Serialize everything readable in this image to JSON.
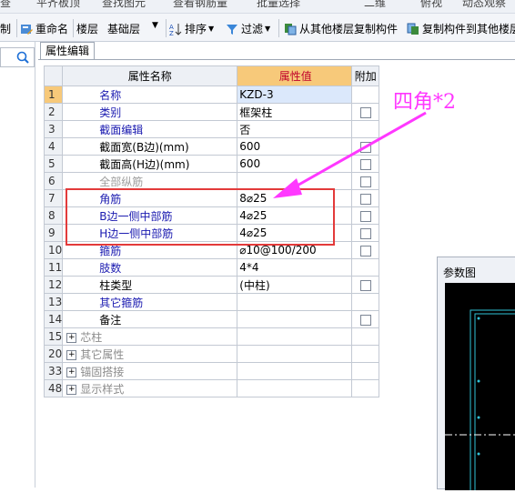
{
  "toolbar_top": {
    "items": [
      "查",
      "平齐板顶",
      "查找图元",
      "查看钢筋量",
      "批量选择",
      "二维",
      "俯视",
      "动态观察"
    ]
  },
  "toolbar": {
    "items": [
      {
        "label": "制"
      },
      {
        "label": "重命名"
      },
      {
        "label": "楼层"
      },
      {
        "label": "基础层"
      },
      {
        "label": "排序"
      },
      {
        "label": "过滤"
      },
      {
        "label": "从其他楼层复制构件"
      },
      {
        "label": "复制构件到其他楼层"
      }
    ]
  },
  "tab": {
    "label": "属性编辑"
  },
  "grid": {
    "headers": {
      "num": "",
      "name": "属性名称",
      "value": "属性值",
      "add": "附加"
    },
    "rows": [
      {
        "num": "1",
        "name": "名称",
        "value": "KZD-3",
        "check": false,
        "style": "blue",
        "selected": true
      },
      {
        "num": "2",
        "name": "类别",
        "value": "框架柱",
        "check": true,
        "style": "blue"
      },
      {
        "num": "3",
        "name": "截面编辑",
        "value": "否",
        "check": false,
        "style": "blue"
      },
      {
        "num": "4",
        "name": "截面宽(B边)(mm)",
        "value": "600",
        "check": true,
        "style": "black"
      },
      {
        "num": "5",
        "name": "截面高(H边)(mm)",
        "value": "600",
        "check": true,
        "style": "black"
      },
      {
        "num": "6",
        "name": "全部纵筋",
        "value": "",
        "check": true,
        "style": "gray"
      },
      {
        "num": "7",
        "name": "角筋",
        "value": "8⌀25",
        "check": true,
        "style": "blue"
      },
      {
        "num": "8",
        "name": "B边一侧中部筋",
        "value": "4⌀25",
        "check": true,
        "style": "blue"
      },
      {
        "num": "9",
        "name": "H边一侧中部筋",
        "value": "4⌀25",
        "check": true,
        "style": "blue"
      },
      {
        "num": "10",
        "name": "箍筋",
        "value": "⌀10@100/200",
        "check": true,
        "style": "blue"
      },
      {
        "num": "11",
        "name": "肢数",
        "value": "4*4",
        "check": false,
        "style": "blue"
      },
      {
        "num": "12",
        "name": "柱类型",
        "value": "(中柱)",
        "check": true,
        "style": "black"
      },
      {
        "num": "13",
        "name": "其它箍筋",
        "value": "",
        "check": false,
        "style": "blue"
      },
      {
        "num": "14",
        "name": "备注",
        "value": "",
        "check": true,
        "style": "black"
      }
    ],
    "groups": [
      {
        "num": "15",
        "name": "芯柱"
      },
      {
        "num": "20",
        "name": "其它属性"
      },
      {
        "num": "33",
        "name": "锚固搭接"
      },
      {
        "num": "48",
        "name": "显示样式"
      }
    ]
  },
  "annotation": {
    "text": "四角*2",
    "color": "#ff38ff",
    "box_color": "#e33a3a"
  },
  "param_panel": {
    "title": "参数图",
    "line_color": "#31c3d8"
  }
}
